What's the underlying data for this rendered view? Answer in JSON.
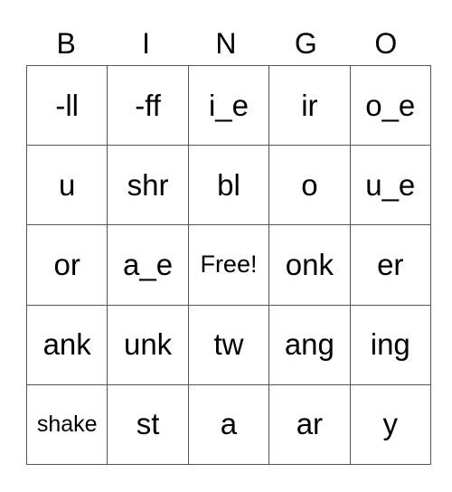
{
  "header": {
    "letters": [
      "B",
      "I",
      "N",
      "G",
      "O"
    ]
  },
  "card": {
    "rows": [
      [
        "-ll",
        "-ff",
        "i_e",
        "ir",
        "o_e"
      ],
      [
        "u",
        "shr",
        "bl",
        "o",
        "u_e"
      ],
      [
        "or",
        "a_e",
        "Free!",
        "onk",
        "er"
      ],
      [
        "ank",
        "unk",
        "tw",
        "ang",
        "ing"
      ],
      [
        "shake",
        "st",
        "a",
        "ar",
        "y"
      ]
    ],
    "free_space": "Free!"
  }
}
